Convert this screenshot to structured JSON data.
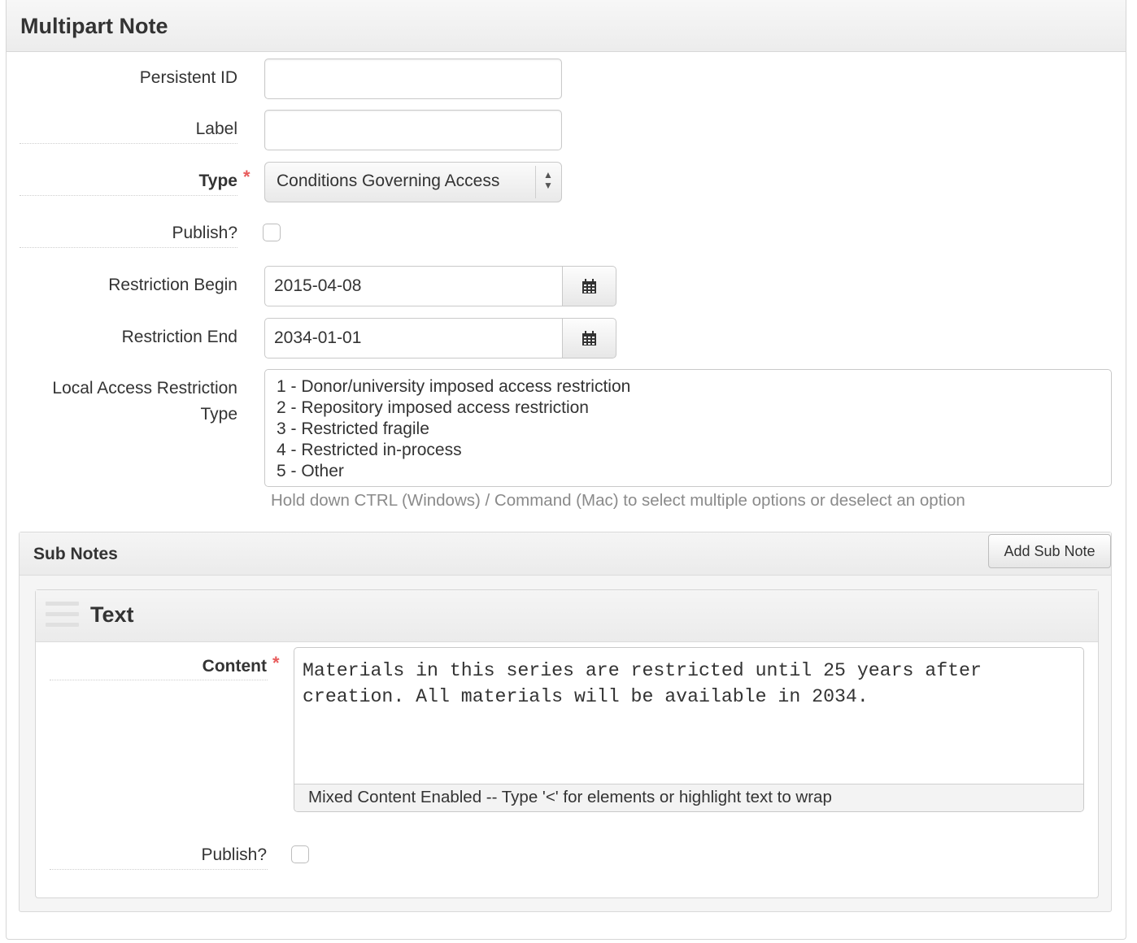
{
  "panel": {
    "title": "Multipart Note"
  },
  "fields": {
    "persistent_id": {
      "label": "Persistent ID",
      "value": ""
    },
    "label": {
      "label": "Label",
      "value": ""
    },
    "type": {
      "label": "Type",
      "required_mark": "*",
      "value": "Conditions Governing Access"
    },
    "publish": {
      "label": "Publish?",
      "checked": false
    },
    "restriction_begin": {
      "label": "Restriction Begin",
      "value": "2015-04-08",
      "icon": "calendar-icon"
    },
    "restriction_end": {
      "label": "Restriction End",
      "value": "2034-01-01",
      "icon": "calendar-icon"
    },
    "local_access": {
      "label_line1": "Local Access Restriction",
      "label_line2": "Type",
      "options": [
        "1 - Donor/university imposed access restriction",
        "2 - Repository imposed access restriction",
        "3 - Restricted fragile",
        "4 - Restricted in-process",
        "5 - Other"
      ],
      "help": "Hold down CTRL (Windows) / Command (Mac) to select multiple options or deselect an option"
    }
  },
  "sub_notes": {
    "title": "Sub Notes",
    "add_label": "Add Sub Note",
    "text_note": {
      "title": "Text",
      "content_label": "Content",
      "required_mark": "*",
      "content": "Materials in this series are restricted until 25 years after creation. All materials will be available in 2034.",
      "footer": "Mixed Content Enabled  --  Type '<' for elements or highlight text to wrap",
      "publish_label": "Publish?",
      "publish_checked": false
    }
  },
  "colors": {
    "required": "#e85b5b",
    "help_text": "#8a8a8a"
  }
}
